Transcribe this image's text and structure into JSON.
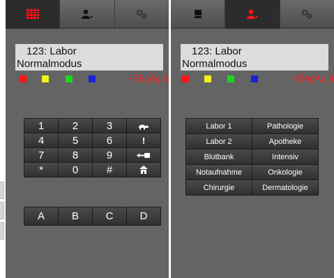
{
  "display": {
    "line1": "123: Labor",
    "line2": "Normalmodus"
  },
  "status_text": "~ÈëçÀç ã",
  "leds": [
    {
      "color": "red",
      "hex": "#ff1515"
    },
    {
      "color": "yellow",
      "hex": "#f2f21e"
    },
    {
      "color": "green",
      "hex": "#1fd51f"
    },
    {
      "color": "blue",
      "hex": "#1c22d8"
    }
  ],
  "tabs_left": [
    {
      "icon": "keypad-grid-icon",
      "active": true
    },
    {
      "icon": "user-icon",
      "active": false
    },
    {
      "icon": "gears-icon",
      "active": false
    }
  ],
  "tabs_right": [
    {
      "icon": "book-icon",
      "active": false
    },
    {
      "icon": "user-icon",
      "active": true
    },
    {
      "icon": "gears-icon",
      "active": false
    }
  ],
  "keypad": {
    "row1": [
      "1",
      "2",
      "3"
    ],
    "row2": [
      "4",
      "5",
      "6",
      "!"
    ],
    "row3": [
      "7",
      "8",
      "9"
    ],
    "row4": [
      "*",
      "0",
      "#"
    ],
    "icons": [
      "turtle-icon",
      "key-icon",
      "home-icon"
    ]
  },
  "abcd": [
    "A",
    "B",
    "C",
    "D"
  ],
  "departments": [
    "Labor 1",
    "Pathologie",
    "Labor 2",
    "Apotheke",
    "Blutbank",
    "Intensiv",
    "Notaufnahme",
    "Onkologie",
    "Chirurgie",
    "Dermatologie"
  ]
}
